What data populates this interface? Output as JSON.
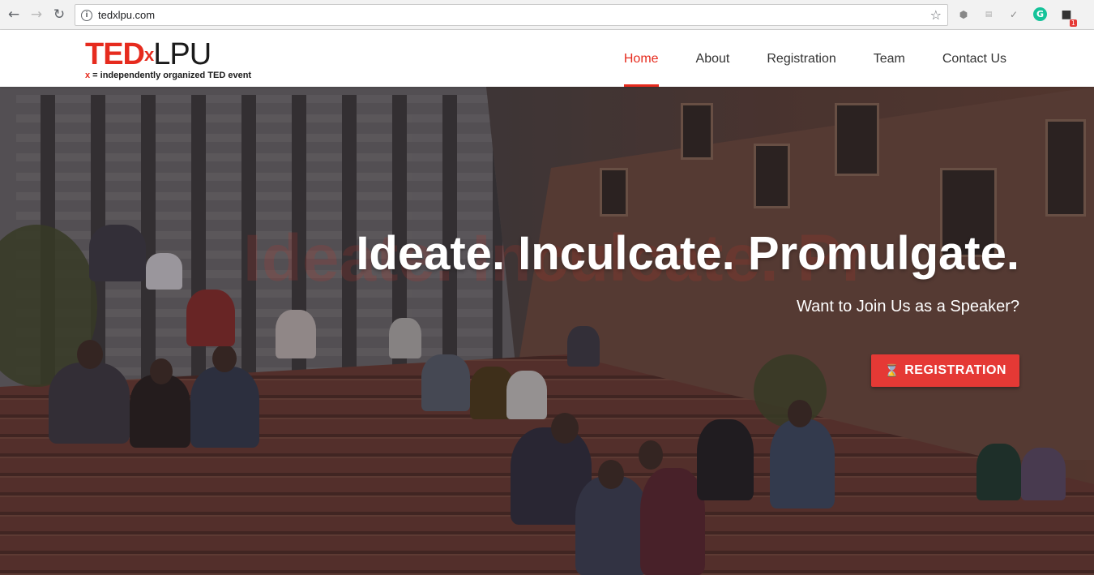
{
  "browser": {
    "url": "tedxlpu.com",
    "ext_badge": "1"
  },
  "logo": {
    "ted": "TED",
    "x": "x",
    "lpu": "LPU",
    "tag_x": "x",
    "tagline": " = independently organized TED event"
  },
  "nav": {
    "items": [
      {
        "label": "Home",
        "active": true
      },
      {
        "label": "About"
      },
      {
        "label": "Registration"
      },
      {
        "label": "Team"
      },
      {
        "label": "Contact Us"
      }
    ]
  },
  "hero": {
    "watermark": "Ideate. Inculcate. Pr",
    "title": "Ideate. Inculcate. Promulgate.",
    "subtitle": "Want to Join Us as a Speaker?",
    "button_label": "REGISTRATION",
    "button_icon": "hourglass-icon"
  },
  "colors": {
    "accent": "#e62b1e",
    "button": "#e53935"
  }
}
